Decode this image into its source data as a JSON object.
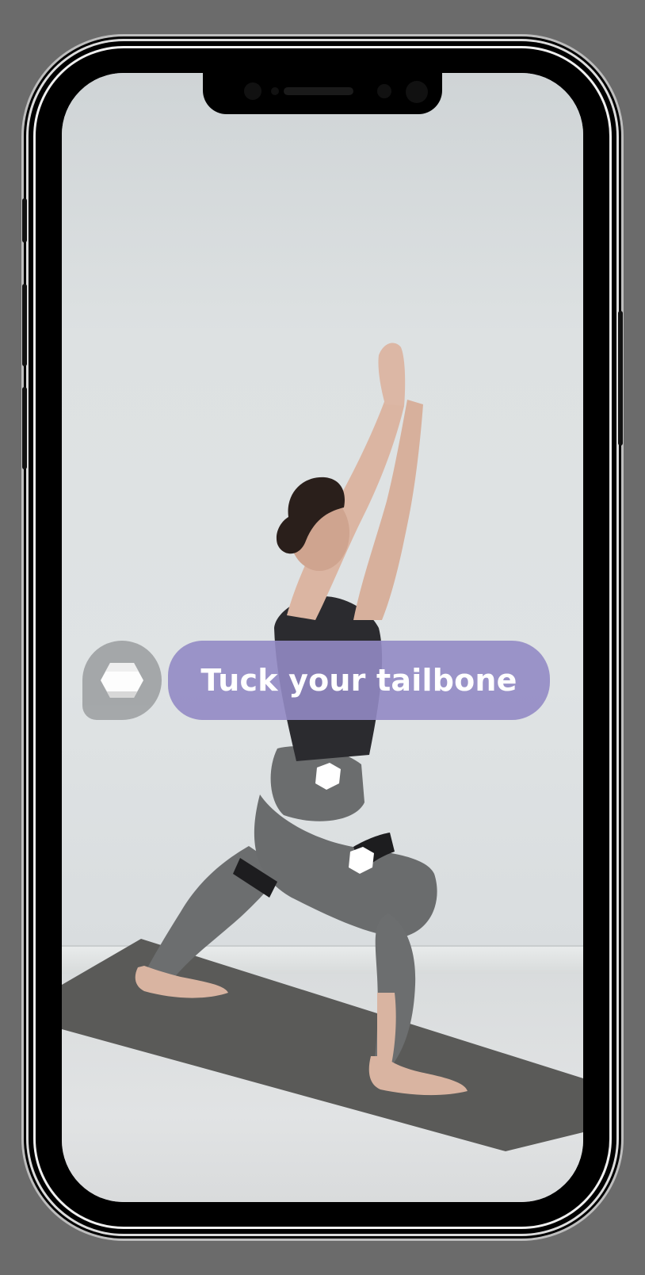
{
  "overlay": {
    "cue_text": "Tuck your tailbone",
    "badge_icon": "sensor-hexagon-icon"
  },
  "colors": {
    "cue_pill": "#928ac4",
    "badge": "#a1a4a6",
    "phone_frame": "#000000"
  }
}
